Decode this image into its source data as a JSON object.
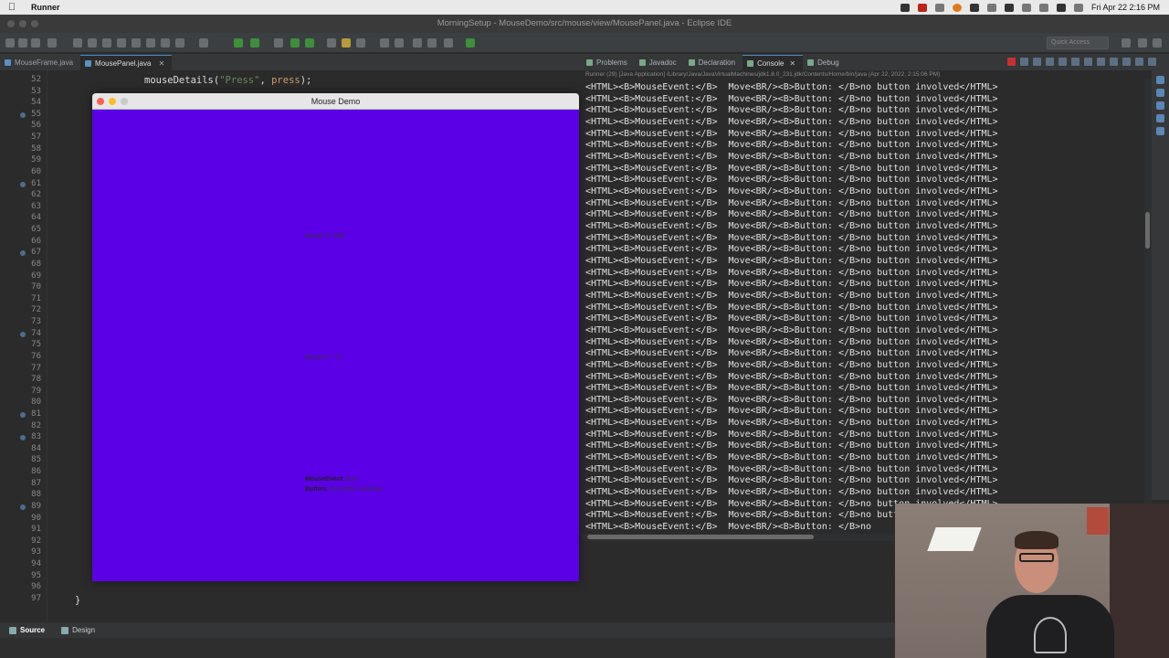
{
  "menubar": {
    "app_name": "Runner",
    "datetime": "Fri Apr 22  2:16 PM"
  },
  "window_title": "MorningSetup - MouseDemo/src/mouse/view/MousePanel.java - Eclipse IDE",
  "toolbar": {
    "quick_access": "Quick Access"
  },
  "editor": {
    "tabs": [
      {
        "label": "MouseFrame.java",
        "active": false
      },
      {
        "label": "MousePanel.java",
        "active": true
      }
    ],
    "line_numbers": [
      "52",
      "53",
      "54",
      "55",
      "56",
      "57",
      "58",
      "59",
      "60",
      "61",
      "62",
      "63",
      "64",
      "65",
      "66",
      "67",
      "68",
      "69",
      "70",
      "71",
      "72",
      "73",
      "74",
      "75",
      "76",
      "77",
      "78",
      "79",
      "80",
      "81",
      "82",
      "83",
      "84",
      "85",
      "86",
      "87",
      "88",
      "89",
      "90",
      "91",
      "92",
      "93",
      "94",
      "95",
      "96",
      "97"
    ],
    "code_line_52": {
      "method": "mouseDetails(",
      "arg_string": "\"Press\"",
      "sep": ", ",
      "arg_var": "press",
      "end": ");"
    },
    "code_line_97": "}",
    "bottom_tabs": {
      "source": "Source",
      "design": "Design"
    }
  },
  "mouse_demo": {
    "title": "Mouse Demo",
    "mouse_x": "Mouse X: 528",
    "mouse_y": "Mouse Y: -17",
    "event_label": "MouseEvent:",
    "event_value": "Exit",
    "button_label": "Button:",
    "button_value": "no button involved",
    "background_color": "#5b00e6"
  },
  "views": {
    "tabs": [
      {
        "label": "Problems",
        "active": false
      },
      {
        "label": "Javadoc",
        "active": false
      },
      {
        "label": "Declaration",
        "active": false
      },
      {
        "label": "Console",
        "active": true
      },
      {
        "label": "Debug",
        "active": false
      }
    ],
    "console_header": "Runner (29) [Java Application] /Library/Java/JavaVirtualMachines/jdk1.8.0_231.jdk/Contents/Home/bin/java (Apr 22, 2022, 2:15:06 PM)",
    "console_line": "<HTML><B>MouseEvent:</B>  Move<BR/><B>Button: </B>no button involved</HTML>",
    "console_last_line": "<HTML><B>MouseEvent:</B>  Move<BR/><B>Button: </B>no"
  }
}
